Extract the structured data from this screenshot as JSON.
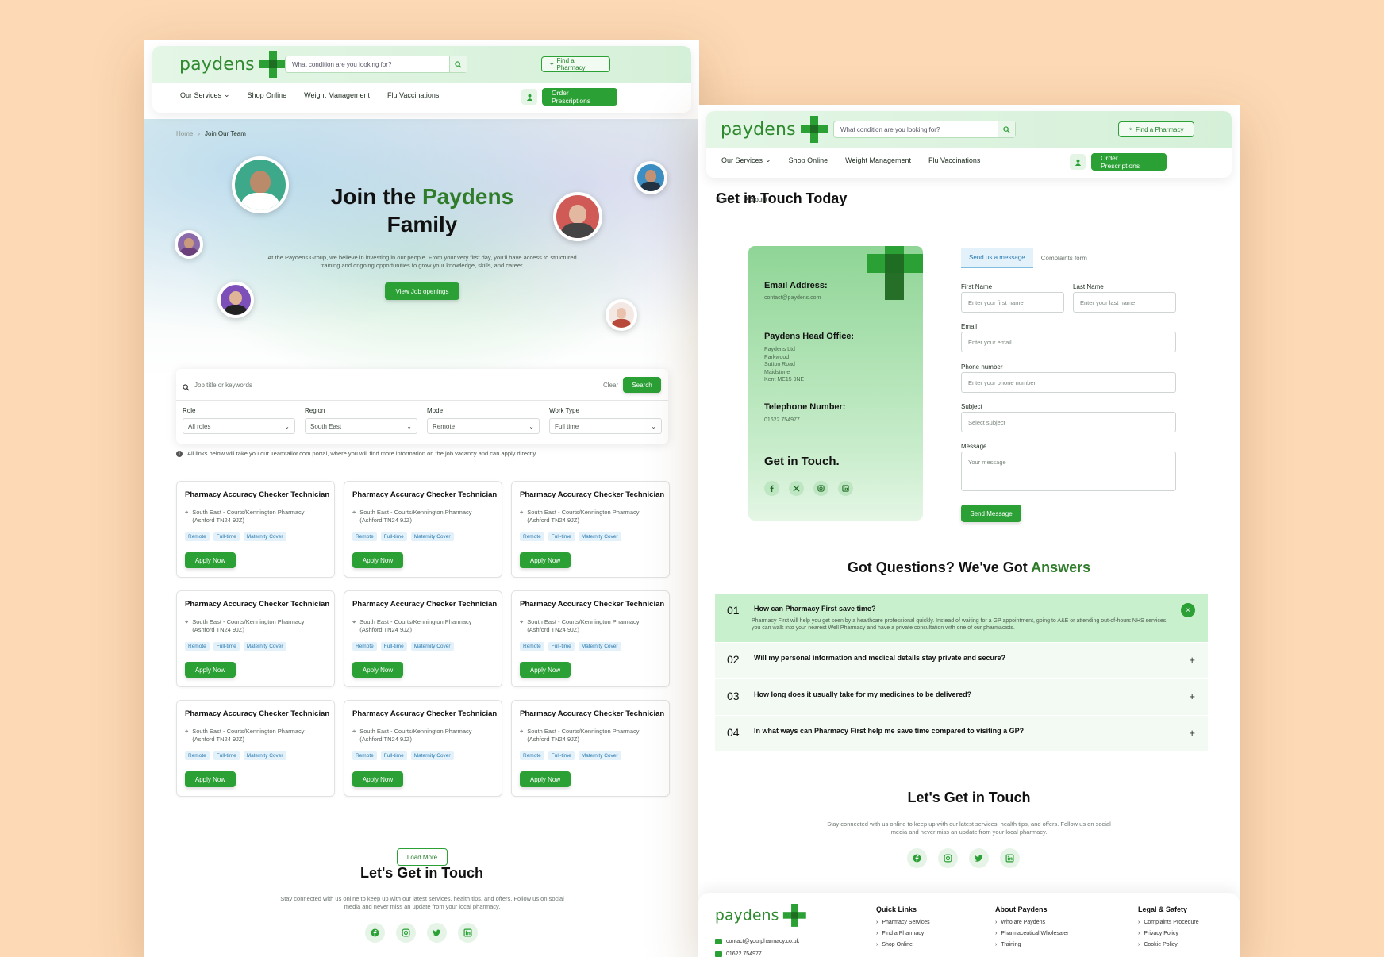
{
  "brand": {
    "logo": "paydens",
    "accent": "#2aa035",
    "dark_accent": "#2f7d2b",
    "background": "#fdd9b5"
  },
  "header": {
    "search_placeholder": "What condition are you looking for?",
    "find_pharmacy": "Find a Pharmacy",
    "nav": [
      "Our Services",
      "Shop Online",
      "Weight Management",
      "Flu Vaccinations"
    ],
    "order_prescriptions": "Order Prescriptions"
  },
  "left": {
    "breadcrumb": {
      "home": "Home",
      "current": "Join Our Team"
    },
    "hero": {
      "title_a": "Join the ",
      "title_b": "Paydens",
      "title_c": "Family",
      "description": "At the Paydens Group, we believe in investing in our people. From your very first day, you'll have access to structured training and ongoing opportunities to grow your knowledge, skills, and career.",
      "cta": "View Job openings"
    },
    "search": {
      "placeholder": "Job title or keywords",
      "clear": "Clear",
      "button": "Search",
      "filters": [
        {
          "label": "Role",
          "value": "All roles"
        },
        {
          "label": "Region",
          "value": "South East"
        },
        {
          "label": "Mode",
          "value": "Remote"
        },
        {
          "label": "Work Type",
          "value": "Full time"
        }
      ]
    },
    "info": "All links below will take you our Teamtailor.com portal, where you will find more information on the job vacancy and can apply directly.",
    "job": {
      "title": "Pharmacy Accuracy Checker Technician",
      "location_line1": "South East - Courts/Kennington Pharmacy",
      "location_line2": "(Ashford TN24 9JZ)",
      "tags": [
        "Remote",
        "Full-time",
        "Maternity Cover"
      ],
      "apply": "Apply Now"
    },
    "load_more": "Load More",
    "touch": {
      "title": "Let's Get in Touch",
      "description": "Stay connected with us online to keep up with our latest services, health tips, and offers. Follow us on social media and never miss an update from your local pharmacy."
    }
  },
  "right": {
    "breadcrumb": {
      "home": "Home",
      "current": "Account"
    },
    "title": "Get in Touch Today",
    "card": {
      "email_label": "Email Address:",
      "email": "contact@paydens.com",
      "office_label": "Paydens Head Office:",
      "office_lines": [
        "Paydens Ltd",
        "Parkwood",
        "Sutton Road",
        "Maidstone",
        "Kent ME15 9NE"
      ],
      "phone_label": "Telephone Number:",
      "phone": "01622 754977",
      "get_in_touch": "Get in Touch."
    },
    "tabs": [
      "Send us a message",
      "Complaints form"
    ],
    "form": {
      "first_name": {
        "label": "First Name",
        "placeholder": "Enter your first name"
      },
      "last_name": {
        "label": "Last Name",
        "placeholder": "Enter your last name"
      },
      "email": {
        "label": "Email",
        "placeholder": "Enter your email"
      },
      "phone": {
        "label": "Phone number",
        "placeholder": "Enter your phone number"
      },
      "subject": {
        "label": "Subject",
        "placeholder": "Select subject"
      },
      "message": {
        "label": "Message",
        "placeholder": "Your message"
      },
      "send": "Send Message"
    },
    "faq": {
      "title_a": "Got Questions?  We've Got ",
      "title_b": "Answers",
      "items": [
        {
          "n": "01",
          "q": "How can Pharmacy First save time?",
          "a": "Pharmacy First will help you get seen by a healthcare professional quickly. Instead of waiting for a GP appointment, going to A&E or attending out-of-hours NHS services, you can walk into your nearest Well Pharmacy and have a private consultation with one of our pharmacists."
        },
        {
          "n": "02",
          "q": "Will my personal information and medical details stay private and secure?"
        },
        {
          "n": "03",
          "q": "How long does it usually take for my medicines to be delivered?"
        },
        {
          "n": "04",
          "q": "In what ways can Pharmacy First help me save time compared to visiting a GP?"
        }
      ]
    },
    "touch": {
      "title": "Let's Get in Touch",
      "description": "Stay connected with us online to keep up with our latest services, health tips, and offers. Follow us on social media and never miss an update from your local pharmacy."
    },
    "footer": {
      "email": "contact@yourpharmacy.co.uk",
      "phone": "01622 754977",
      "quick_links": {
        "title": "Quick Links",
        "items": [
          "Pharmacy Services",
          "Find a Pharmacy",
          "Shop Online"
        ]
      },
      "about": {
        "title": "About Paydens",
        "items": [
          "Who are Paydens",
          "Pharmaceutical Wholesaler",
          "Training"
        ]
      },
      "legal": {
        "title": "Legal & Safety",
        "items": [
          "Complaints Procedure",
          "Privacy Policy",
          "Cookie Policy"
        ]
      }
    }
  }
}
